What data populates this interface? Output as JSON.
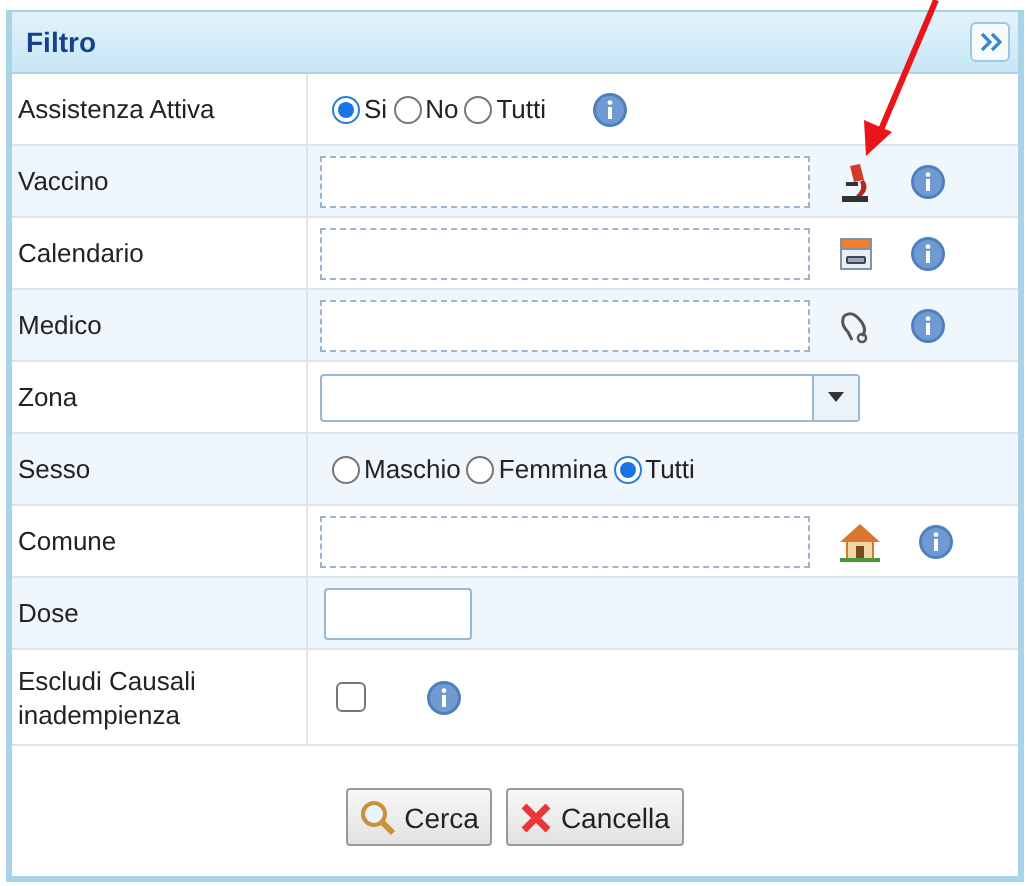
{
  "panel": {
    "title": "Filtro"
  },
  "rows": [
    {
      "label": "Assistenza Attiva",
      "kind": "radio",
      "info": true,
      "options": [
        {
          "label": "Si",
          "selected": true
        },
        {
          "label": "No",
          "selected": false
        },
        {
          "label": "Tutti",
          "selected": false
        }
      ]
    },
    {
      "label": "Vaccino",
      "kind": "lookup",
      "info": true
    },
    {
      "label": "Calendario",
      "kind": "lookup",
      "info": true
    },
    {
      "label": "Medico",
      "kind": "lookup",
      "info": true
    },
    {
      "label": "Zona",
      "kind": "select",
      "info": false
    },
    {
      "label": "Sesso",
      "kind": "radio",
      "info": false,
      "options": [
        {
          "label": "Maschio",
          "selected": false
        },
        {
          "label": "Femmina",
          "selected": false
        },
        {
          "label": "Tutti",
          "selected": true
        }
      ]
    },
    {
      "label": "Comune",
      "kind": "lookup",
      "info": true
    },
    {
      "label": "Dose",
      "kind": "text",
      "info": false
    },
    {
      "label": "Escludi Causali inadempienza",
      "kind": "checkbox",
      "info": true,
      "checked": false
    }
  ],
  "buttons": [
    {
      "label": "Cerca",
      "kind": "search"
    },
    {
      "label": "Cancella",
      "kind": "cancel"
    }
  ]
}
